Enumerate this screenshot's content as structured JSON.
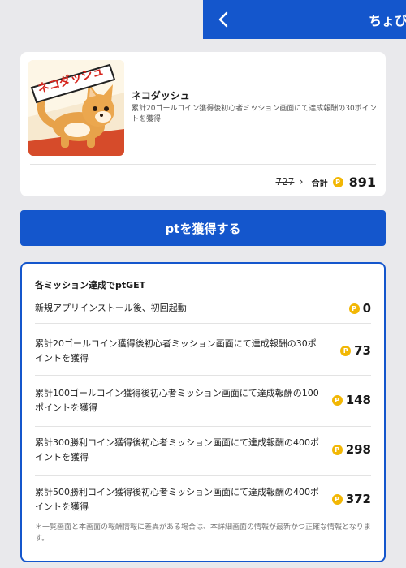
{
  "header": {
    "title": "ちょび",
    "back_icon": "chevron-left-icon"
  },
  "offer": {
    "app_name": "ネコダッシュ",
    "description": "累計20ゴールコイン獲得後初心者ミッション画面にて達成報酬の30ポイントを獲得",
    "old_points": "727",
    "total_label": "合計",
    "total_points": "891",
    "coin_symbol": "P",
    "icon_text": "ネコダッシュ"
  },
  "get_button_label": "ptを獲得する",
  "missions": {
    "title": "各ミッション達成でptGET",
    "items": [
      {
        "text": "新規アプリインストール後、初回起動",
        "points": "0"
      },
      {
        "text": "累計20ゴールコイン獲得後初心者ミッション画面にて達成報酬の30ポイントを獲得",
        "points": "73"
      },
      {
        "text": "累計100ゴールコイン獲得後初心者ミッション画面にて達成報酬の100ポイントを獲得",
        "points": "148"
      },
      {
        "text": "累計300勝利コイン獲得後初心者ミッション画面にて達成報酬の400ポイントを獲得",
        "points": "298"
      },
      {
        "text": "累計500勝利コイン獲得後初心者ミッション画面にて達成報酬の400ポイントを獲得",
        "points": "372"
      }
    ],
    "note": "＊一覧画面と本画面の報酬情報に差異がある場合は、本詳細画面の情報が最新かつ正確な情報となります。"
  },
  "colors": {
    "brand_blue": "#1456cc",
    "coin_gold": "#f2b705",
    "background": "#e9e9ec"
  }
}
